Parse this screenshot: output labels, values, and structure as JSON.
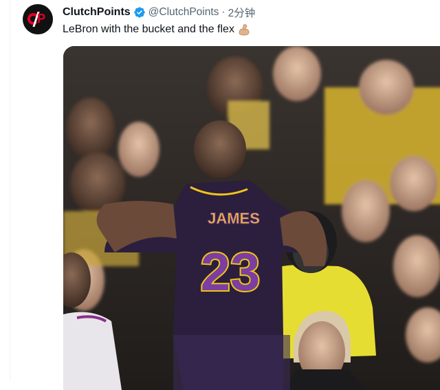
{
  "tweet": {
    "display_name": "ClutchPoints",
    "handle": "@ClutchPoints",
    "separator": "·",
    "timestamp": "2分钟",
    "text": "LeBron with the bucket and the flex",
    "emoji": "flexed-biceps-emoji"
  },
  "avatar": {
    "icon": "clutchpoints-logo-icon",
    "brand_color": "#e4002b"
  },
  "media": {
    "jersey_name": "JAMES",
    "jersey_number": "23",
    "jersey_color": "#2b1f3d",
    "trim_color": "#f2c418"
  },
  "colors": {
    "verified": "#1d9bf0",
    "secondary_text": "#536471"
  }
}
